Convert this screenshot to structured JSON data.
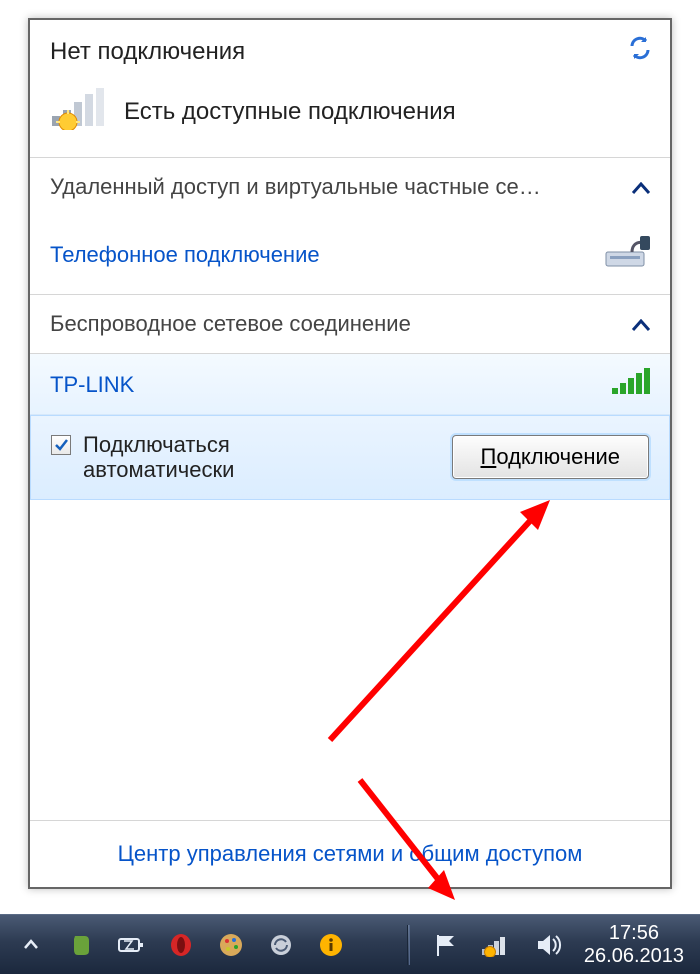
{
  "header": {
    "title": "Нет подключения"
  },
  "status": {
    "text": "Есть доступные подключения"
  },
  "sections": {
    "dialup": {
      "title": "Удаленный доступ и виртуальные частные се…",
      "item": "Телефонное подключение"
    },
    "wifi": {
      "title": "Беспроводное сетевое соединение",
      "network": "TP-LINK",
      "auto_label": "Подключаться\nавтоматически",
      "connect_btn_u": "П",
      "connect_btn_rest": "одключение"
    }
  },
  "footer": {
    "link": "Центр управления сетями и общим доступом"
  },
  "taskbar": {
    "time": "17:56",
    "date": "26.06.2013"
  }
}
